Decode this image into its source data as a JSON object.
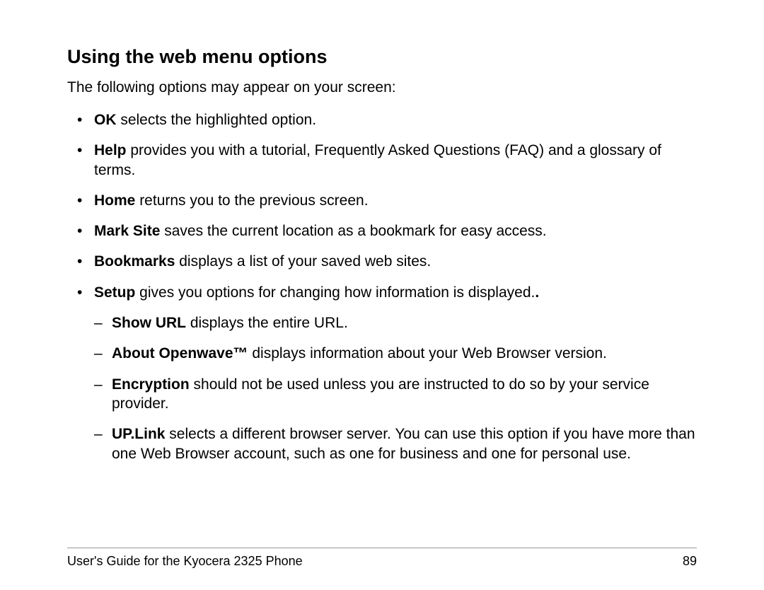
{
  "heading": "Using the web menu options",
  "intro": "The following options may appear on your screen:",
  "items": [
    {
      "bold": "OK",
      "rest": " selects the highlighted option."
    },
    {
      "bold": "Help",
      "rest": " provides you with a tutorial, Frequently Asked Questions (FAQ) and a glossary of terms."
    },
    {
      "bold": "Home",
      "rest": " returns you to the previous screen."
    },
    {
      "bold": "Mark Site",
      "rest": " saves the current location as a bookmark for easy access."
    },
    {
      "bold": "Bookmarks",
      "rest": " displays a list of your saved web sites."
    },
    {
      "bold": "Setup",
      "rest": " gives you options for changing how information is displayed."
    }
  ],
  "subitems": [
    {
      "bold": "Show URL",
      "rest": " displays the entire URL."
    },
    {
      "bold": "About Openwave™",
      "rest": " displays information about your Web Browser version."
    },
    {
      "bold": "Encryption",
      "rest": " should not be used unless you are instructed to do so by your service provider."
    },
    {
      "bold": "UP.Link",
      "rest": " selects a different browser server. You can use this option if you have more than one Web Browser account, such as one for business and one for personal use."
    }
  ],
  "footer": {
    "left": "User's Guide for the Kyocera 2325 Phone",
    "right": "89"
  }
}
